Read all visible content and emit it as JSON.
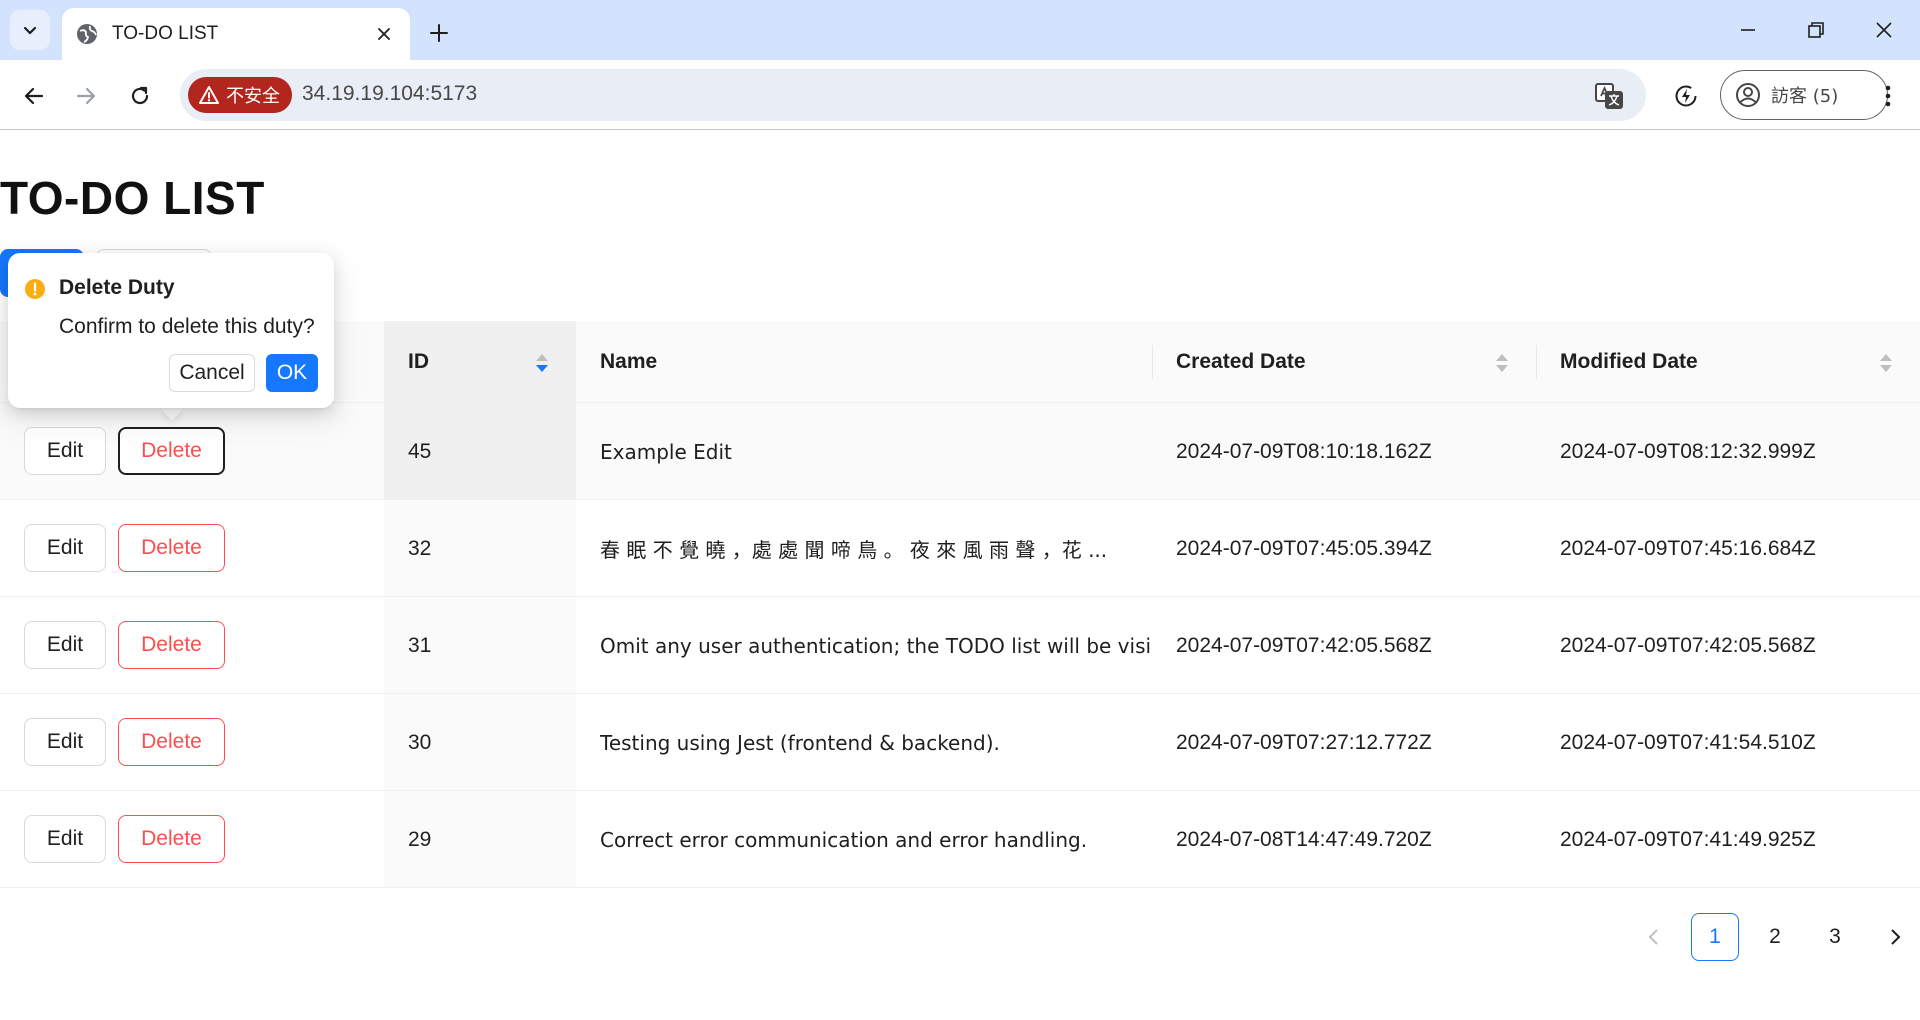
{
  "browser": {
    "tab_title": "TO-DO LIST",
    "url": "34.19.19.104:5173",
    "security_label": "不安全",
    "profile_label": "訪客 (5)"
  },
  "page": {
    "title": "TO-DO LIST"
  },
  "table": {
    "columns": {
      "id": "ID",
      "name": "Name",
      "created": "Created Date",
      "modified": "Modified Date"
    },
    "sorted_column": "ID",
    "action_labels": {
      "edit": "Edit",
      "delete": "Delete"
    },
    "rows": [
      {
        "id": "45",
        "name": "Example Edit",
        "created": "2024-07-09T08:10:18.162Z",
        "modified": "2024-07-09T08:12:32.999Z"
      },
      {
        "id": "32",
        "name": "春 眠 不 覺 曉 ，處 處 聞 啼 鳥 。 夜 來 風 雨 聲 ，花 ...",
        "created": "2024-07-09T07:45:05.394Z",
        "modified": "2024-07-09T07:45:16.684Z"
      },
      {
        "id": "31",
        "name": "Omit any user authentication; the TODO list will be visi...",
        "created": "2024-07-09T07:42:05.568Z",
        "modified": "2024-07-09T07:42:05.568Z"
      },
      {
        "id": "30",
        "name": "Testing using Jest (frontend & backend).",
        "created": "2024-07-09T07:27:12.772Z",
        "modified": "2024-07-09T07:41:54.510Z"
      },
      {
        "id": "29",
        "name": "Correct error communication and error handling.",
        "created": "2024-07-08T14:47:49.720Z",
        "modified": "2024-07-09T07:41:49.925Z"
      }
    ]
  },
  "pagination": {
    "pages": [
      "1",
      "2",
      "3"
    ],
    "current": "1"
  },
  "popconfirm": {
    "title": "Delete Duty",
    "description": "Confirm to delete this duty?",
    "cancel_label": "Cancel",
    "ok_label": "OK"
  },
  "colors": {
    "primary": "#1677ff",
    "danger": "#ff4d4f",
    "warning": "#faad14",
    "insecure": "#b3261e",
    "tabstrip": "#d3e3fd"
  }
}
